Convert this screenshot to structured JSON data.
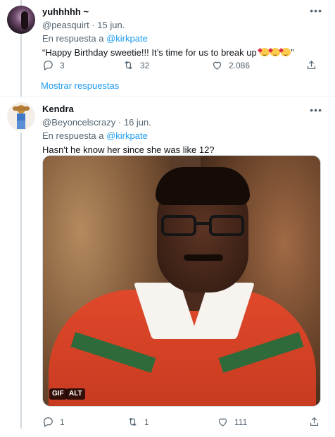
{
  "tweet1": {
    "name": "yuhhhhh ~",
    "handle": "@peasquirt",
    "date": "15 jun.",
    "reply_prefix": "En respuesta a",
    "reply_mention": "@kirkpate",
    "text_before": "“Happy Birthday sweetie!!! It’s time for us to break up ",
    "text_after": "”",
    "emojis": [
      "smiling-face-with-hearts",
      "smiling-face-with-hearts",
      "smiling-face-with-hearts"
    ],
    "replies": "3",
    "retweets": "32",
    "likes": "2.086"
  },
  "show_replies": "Mostrar respuestas",
  "tweet2": {
    "name": "Kendra",
    "handle": "@Beyoncelscrazy",
    "date": "16 jun.",
    "reply_prefix": "En respuesta a",
    "reply_mention": "@kirkpate",
    "text": "Hasn't he know her since she was like 12?",
    "badges": {
      "gif": "GIF",
      "alt": "ALT"
    },
    "replies": "1",
    "retweets": "1",
    "likes": "111"
  },
  "separator_dot": "·",
  "more_glyph": "•••",
  "colors": {
    "link": "#1d9bf0",
    "secondary": "#536471",
    "line": "#cfd9de"
  }
}
